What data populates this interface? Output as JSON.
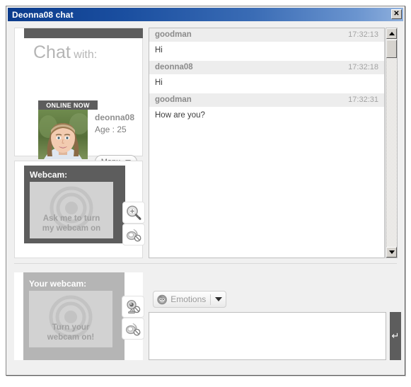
{
  "window": {
    "title": "Deonna08 chat",
    "close_label": "✕"
  },
  "profile": {
    "heading_big": "Chat",
    "heading_small": "with:",
    "status_badge": "ONLINE NOW",
    "username": "deonna08",
    "age_label": "Age : 25",
    "menu_label": "Menu",
    "avatar_icon": "user-photo"
  },
  "partner_webcam": {
    "title": "Webcam:",
    "placeholder_line1": "Ask me to turn",
    "placeholder_line2": "my webcam on",
    "zoom_icon": "magnifier-plus-icon",
    "sound_icon": "speaker-muted-icon"
  },
  "my_webcam": {
    "title": "Your webcam:",
    "placeholder_line1": "Turn your",
    "placeholder_line2": "webcam on!",
    "camera_icon": "webcam-off-icon",
    "sound_icon": "speaker-muted-icon"
  },
  "chat": {
    "messages": [
      {
        "sender": "goodman",
        "time": "17:32:13",
        "text": "Hi"
      },
      {
        "sender": "deonna08",
        "time": "17:32:18",
        "text": "Hi"
      },
      {
        "sender": "goodman",
        "time": "17:32:31",
        "text": "How are you?"
      }
    ]
  },
  "scrollbar": {
    "up_icon": "scroll-up-arrow-icon",
    "down_icon": "scroll-down-arrow-icon"
  },
  "composer": {
    "emotions_label": "Emotions",
    "emotions_icon": "smiley-icon",
    "dropdown_icon": "chevron-down-icon",
    "message_value": "",
    "message_placeholder": "",
    "send_icon": "↵"
  },
  "colors": {
    "titlebar_start": "#0b3b8c",
    "titlebar_end": "#8fb0dd",
    "dark_panel": "#5d5d5d",
    "light_panel": "#b5b5b5",
    "screen_bg": "#d2d2d2",
    "msg_head_bg": "#ededed",
    "window_bg": "#f0f0f0"
  }
}
